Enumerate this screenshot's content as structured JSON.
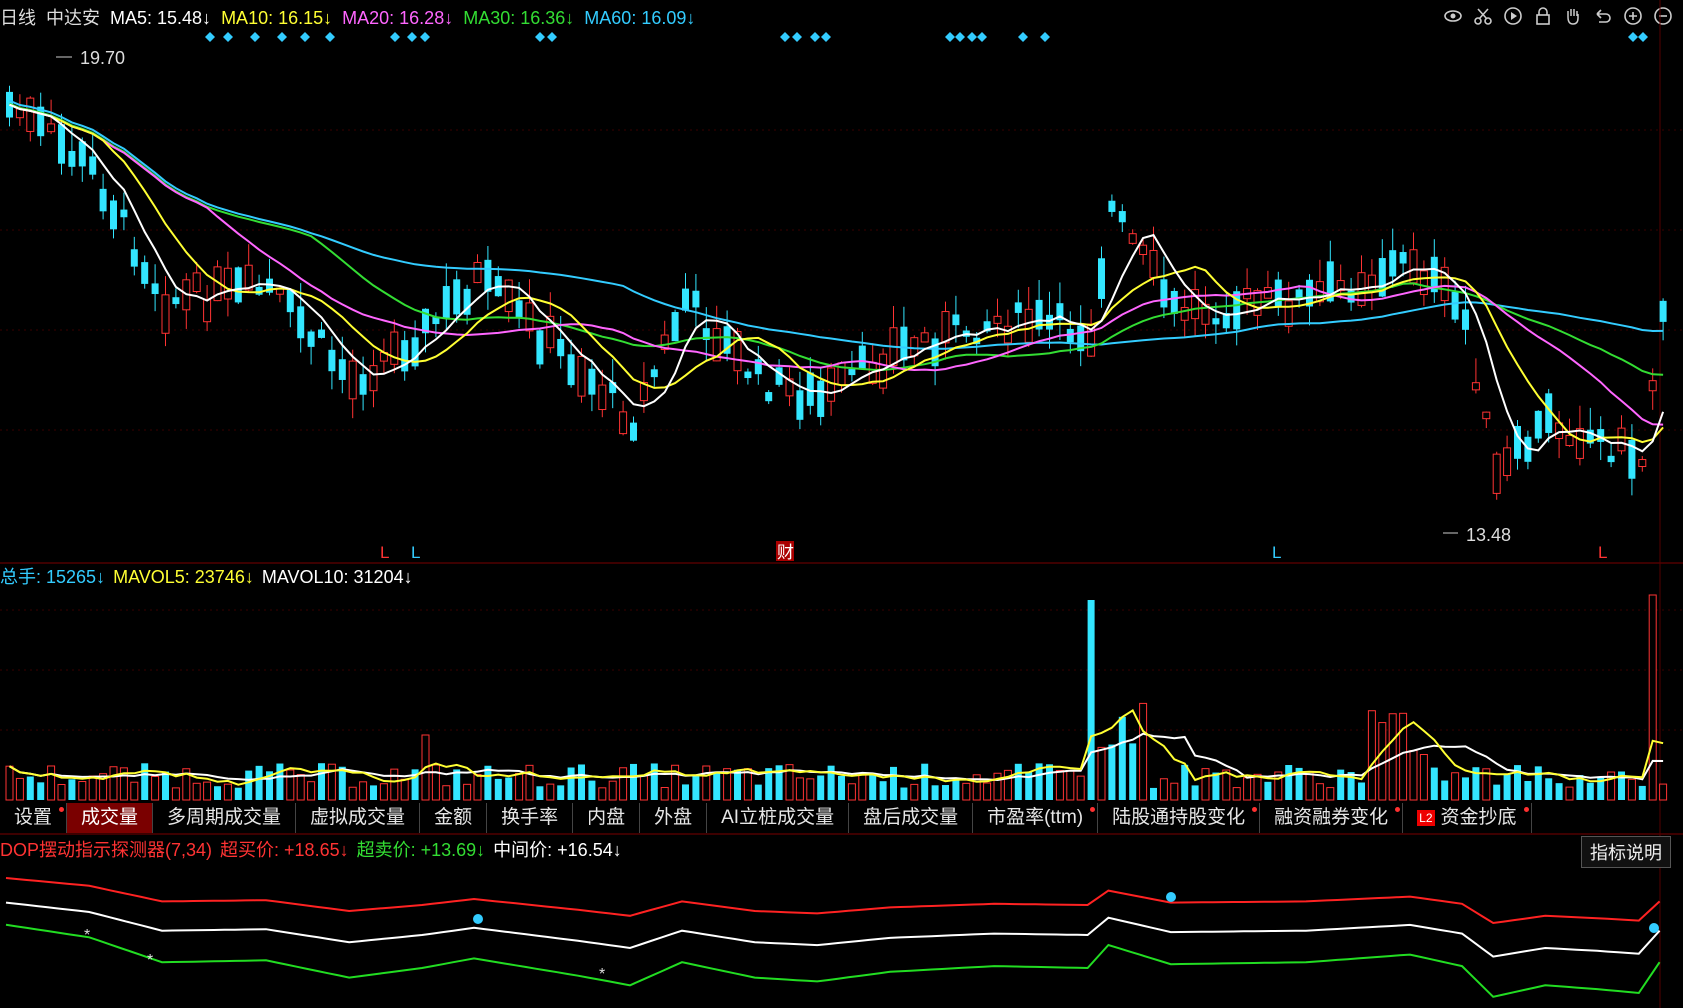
{
  "header": {
    "period": "日线",
    "stock": "中达安",
    "ma": [
      {
        "label": "MA5: 15.48↓",
        "color": "#ffffff"
      },
      {
        "label": "MA10: 16.15↓",
        "color": "#ffff33"
      },
      {
        "label": "MA20: 16.28↓",
        "color": "#ff66ff"
      },
      {
        "label": "MA30: 16.36↓",
        "color": "#33dd33"
      },
      {
        "label": "MA60: 16.09↓",
        "color": "#33ccff"
      }
    ]
  },
  "toolbar": [
    "eye-icon",
    "scissors-icon",
    "play-icon",
    "lock-icon",
    "hand-icon",
    "undo-icon",
    "zoom-in-icon",
    "zoom-out-icon"
  ],
  "price_chart": {
    "high_label": "19.70",
    "low_label": "13.48",
    "markers": [
      "L",
      "L",
      "财",
      "L",
      "L"
    ]
  },
  "volume_header": {
    "total": {
      "label": "总手: ",
      "value": "15265↓"
    },
    "mavol5": "MAVOL5: 23746↓",
    "mavol10": "MAVOL10: 31204↓"
  },
  "tabs": [
    {
      "label": "设置",
      "dot": true
    },
    {
      "label": "成交量",
      "active": true
    },
    {
      "label": "多周期成交量"
    },
    {
      "label": "虚拟成交量"
    },
    {
      "label": "金额"
    },
    {
      "label": "换手率"
    },
    {
      "label": "内盘"
    },
    {
      "label": "外盘"
    },
    {
      "label": "AI立桩成交量"
    },
    {
      "label": "盘后成交量"
    },
    {
      "label": "市盈率(ttm)",
      "dot": true
    },
    {
      "label": "陆股通持股变化",
      "dot": true
    },
    {
      "label": "融资融券变化",
      "dot": true
    },
    {
      "label": "资金抄底",
      "l2": true,
      "dot": true
    }
  ],
  "indicator": {
    "name": "DOP摆动指示探测器(7,34)",
    "buy": "超买价: +18.65↓",
    "sell": "超卖价: +13.69↓",
    "mid": "中间价: +16.54↓",
    "button": "指标说明"
  },
  "colors": {
    "up": "#ff3333",
    "down": "#33e6ff",
    "accent": "#33ccff"
  }
}
